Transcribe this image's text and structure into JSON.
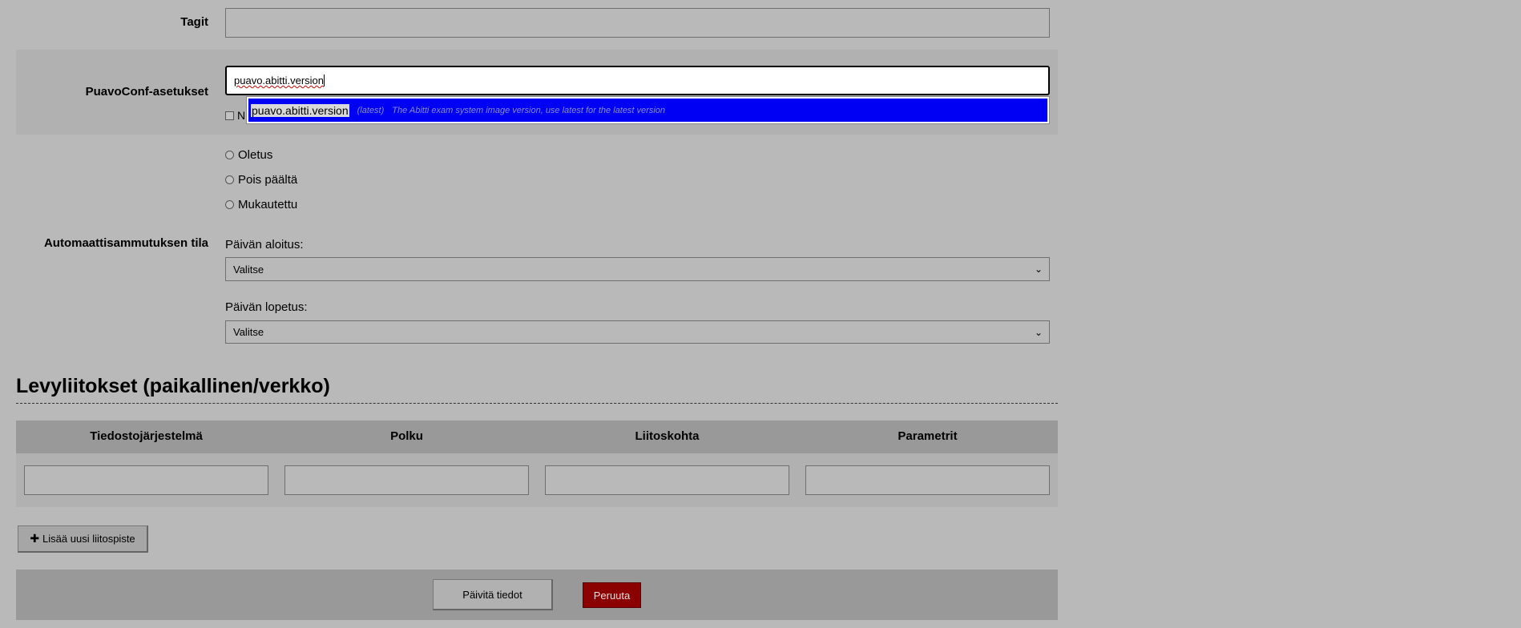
{
  "form": {
    "tags": {
      "label": "Tagit",
      "value": ""
    },
    "puavoconf": {
      "label": "PuavoConf-asetukset",
      "input_value": "puavo.abitti.version",
      "checkbox_label_partial": "N",
      "autocomplete": {
        "key": "puavo.abitti.version",
        "default": "(latest)",
        "description": "The Abitti exam system image version, use latest for the latest version"
      }
    },
    "autoshutdown": {
      "label": "Automaattisammutuksen tila",
      "options": [
        "Oletus",
        "Pois päältä",
        "Mukautettu"
      ],
      "day_start_label": "Päivän aloitus:",
      "day_start_value": "Valitse",
      "day_end_label": "Päivän lopetus:",
      "day_end_value": "Valitse"
    }
  },
  "mounts": {
    "heading": "Levyliitokset (paikallinen/verkko)",
    "columns": [
      "Tiedostojärjestelmä",
      "Polku",
      "Liitoskohta",
      "Parametrit"
    ],
    "add_button": "Lisää uusi liitospiste"
  },
  "actions": {
    "update": "Päivitä tiedot",
    "cancel": "Peruuta"
  },
  "colors": {
    "highlight": "#0000f5",
    "cancel_bg": "#8b0000"
  }
}
